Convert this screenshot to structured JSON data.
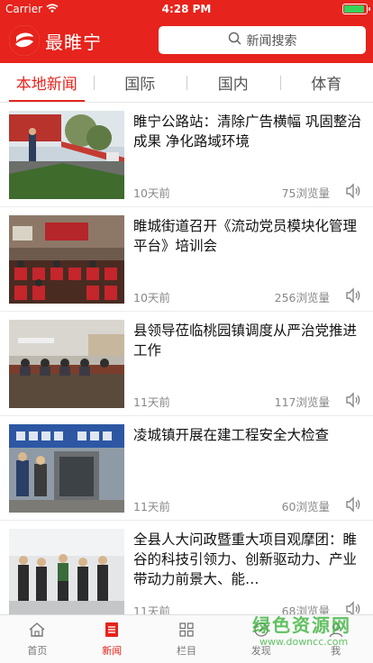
{
  "status_bar": {
    "carrier": "Carrier",
    "time": "4:28 PM"
  },
  "app": {
    "name": "最睢宁",
    "search_label": "新闻搜索"
  },
  "tabs": [
    {
      "label": "本地新闻",
      "active": true
    },
    {
      "label": "国际",
      "active": false
    },
    {
      "label": "国内",
      "active": false
    },
    {
      "label": "体育",
      "active": false
    }
  ],
  "news": [
    {
      "title": "睢宁公路站：清除广告横幅 巩固整治成果 净化路域环境",
      "ago": "10天前",
      "views": "75浏览量"
    },
    {
      "title": "睢城街道召开《流动党员模块化管理平台》培训会",
      "ago": "10天前",
      "views": "256浏览量"
    },
    {
      "title": "县领导莅临桃园镇调度从严治党推进工作",
      "ago": "11天前",
      "views": "117浏览量"
    },
    {
      "title": "凌城镇开展在建工程安全大检查",
      "ago": "11天前",
      "views": "60浏览量"
    },
    {
      "title": "全县人大问政暨重大项目观摩团：睢谷的科技引领力、创新驱动力、产业带动力前景大、能…",
      "ago": "11天前",
      "views": "68浏览量"
    }
  ],
  "bottom_nav": [
    {
      "label": "首页",
      "icon": "home-icon",
      "active": false
    },
    {
      "label": "新闻",
      "icon": "news-icon",
      "active": true
    },
    {
      "label": "栏目",
      "icon": "grid-icon",
      "active": false
    },
    {
      "label": "发现",
      "icon": "discover-icon",
      "active": false
    },
    {
      "label": "我",
      "icon": "user-icon",
      "active": false
    }
  ],
  "watermark": {
    "title": "绿色资源网",
    "url": "www.downcc.com"
  },
  "colors": {
    "brand": "#e6231c",
    "active_tab": "#e6231c",
    "watermark": "#3cb33c"
  }
}
